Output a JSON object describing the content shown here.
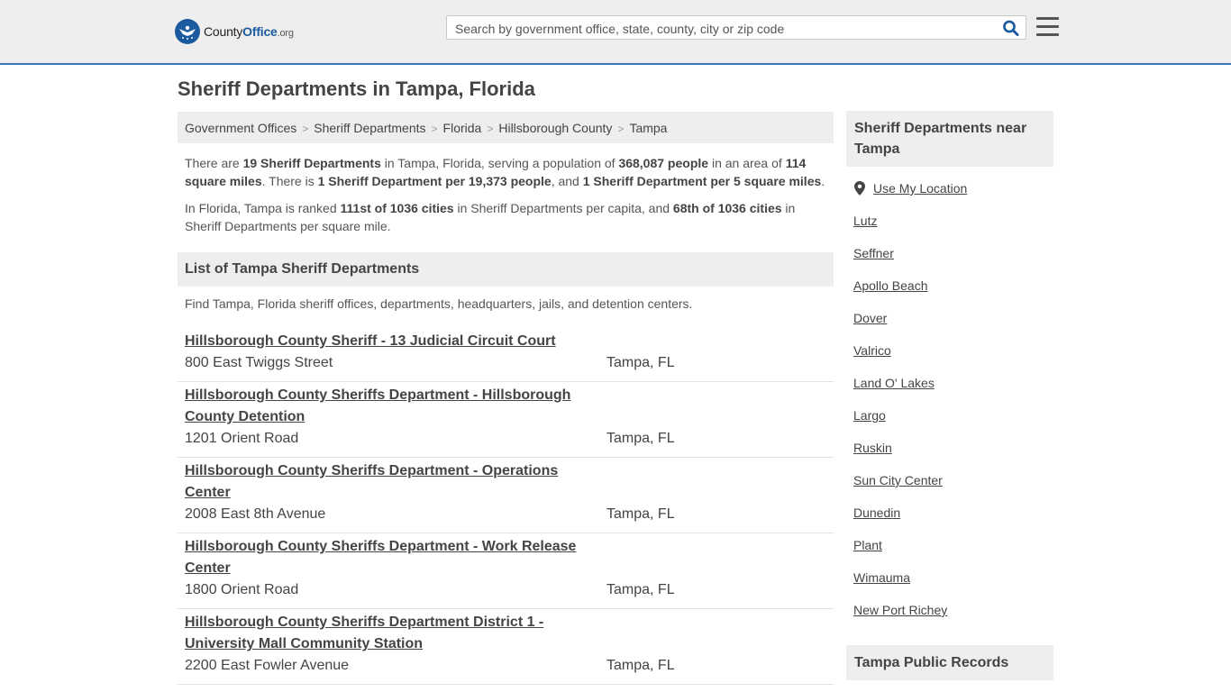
{
  "header": {
    "logo_prefix": "County",
    "logo_brand": "Office",
    "logo_tld": ".org",
    "search_placeholder": "Search by government office, state, county, city or zip code",
    "icons": [
      "search-icon",
      "menu-icon",
      "location-pin-icon"
    ],
    "accent_color": "#3b77b8"
  },
  "page_title": "Sheriff Departments in Tampa, Florida",
  "breadcrumb": [
    "Government Offices",
    "Sheriff Departments",
    "Florida",
    "Hillsborough County",
    "Tampa"
  ],
  "intro": {
    "p1": {
      "t1": "There are ",
      "b1": "19 Sheriff Departments",
      "t2": " in Tampa, Florida, serving a population of ",
      "b2": "368,087 people",
      "t3": " in an area of ",
      "b3": "114 square miles",
      "t4": ". There is ",
      "b4": "1 Sheriff Department per 19,373 people",
      "t5": ", and ",
      "b5": "1 Sheriff Department per 5 square miles",
      "t6": "."
    },
    "p2": {
      "t1": "In Florida, Tampa is ranked ",
      "b1": "111st of 1036 cities",
      "t2": " in Sheriff Departments per capita, and ",
      "b2": "68th of 1036 cities",
      "t3": " in Sheriff Departments per square mile."
    }
  },
  "list": {
    "heading": "List of Tampa Sheriff Departments",
    "subheading": "Find Tampa, Florida sheriff offices, departments, headquarters, jails, and detention centers.",
    "items": [
      {
        "name": "Hillsborough County Sheriff - 13 Judicial Circuit Court",
        "address": "800 East Twiggs Street",
        "city": "Tampa, FL"
      },
      {
        "name": "Hillsborough County Sheriffs Department - Hillsborough County Detention",
        "address": "1201 Orient Road",
        "city": "Tampa, FL"
      },
      {
        "name": "Hillsborough County Sheriffs Department - Operations Center",
        "address": "2008 East 8th Avenue",
        "city": "Tampa, FL"
      },
      {
        "name": "Hillsborough County Sheriffs Department - Work Release Center",
        "address": "1800 Orient Road",
        "city": "Tampa, FL"
      },
      {
        "name": "Hillsborough County Sheriffs Department District 1 - University Mall Community Station",
        "address": "2200 East Fowler Avenue",
        "city": "Tampa, FL"
      }
    ]
  },
  "sidebar": {
    "near_heading": "Sheriff Departments near Tampa",
    "use_location": "Use My Location",
    "near_cities": [
      "Lutz",
      "Seffner",
      "Apollo Beach",
      "Dover",
      "Valrico",
      "Land O' Lakes",
      "Largo",
      "Ruskin",
      "Sun City Center",
      "Dunedin",
      "Plant",
      "Wimauma",
      "New Port Richey"
    ],
    "records_heading": "Tampa Public Records"
  }
}
